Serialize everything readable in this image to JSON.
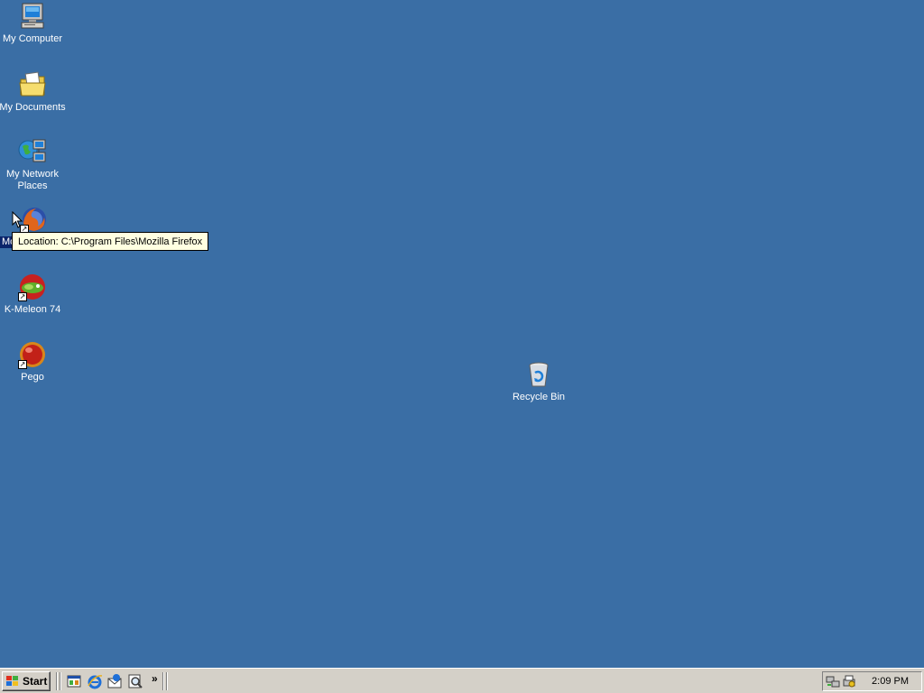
{
  "desktop": {
    "background_color": "#3a6ea5",
    "icons": [
      {
        "label": "My Computer",
        "icon": "computer-icon"
      },
      {
        "label": "My Documents",
        "icon": "folder-documents-icon"
      },
      {
        "label": "My Network Places",
        "icon": "network-places-icon"
      },
      {
        "label": "Mo",
        "icon": "firefox-icon"
      },
      {
        "label": "K-Meleon 74",
        "icon": "k-meleon-icon"
      },
      {
        "label": "Pego",
        "icon": "pego-icon"
      },
      {
        "label": "Recycle Bin",
        "icon": "recycle-bin-icon"
      }
    ]
  },
  "tooltip": {
    "text": "Location: C:\\Program Files\\Mozilla Firefox"
  },
  "taskbar": {
    "start_label": "Start",
    "quick_launch": [
      {
        "icon": "show-desktop-icon"
      },
      {
        "icon": "internet-explorer-icon"
      },
      {
        "icon": "outlook-express-icon"
      },
      {
        "icon": "search-icon"
      }
    ],
    "overflow_label": "»",
    "tray": {
      "icons": [
        {
          "icon": "network-tray-icon"
        },
        {
          "icon": "printer-tray-icon"
        }
      ],
      "clock": "2:09 PM"
    }
  }
}
